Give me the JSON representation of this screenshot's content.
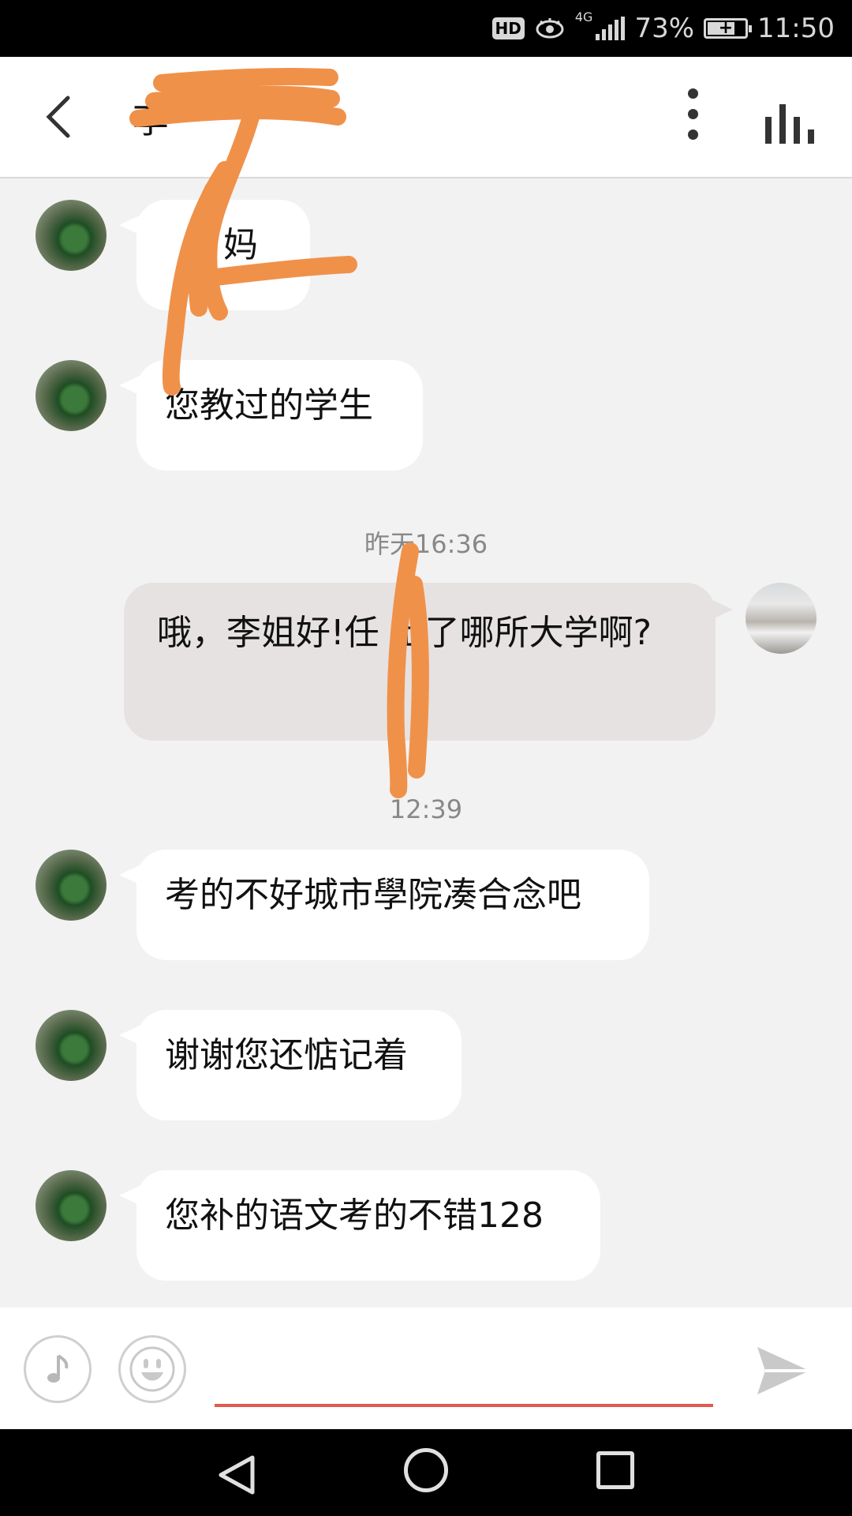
{
  "status_bar": {
    "hd": "HD",
    "network": "4G",
    "battery": "73%",
    "battery_level": 0.73,
    "time": "11:50"
  },
  "header": {
    "title": "李",
    "icons": [
      "back-arrow-icon",
      "more-vertical-icon",
      "stats-bars-icon"
    ]
  },
  "messages": [
    {
      "direction": "in",
      "avatar": "plant",
      "text": "妈"
    },
    {
      "direction": "in",
      "avatar": "plant",
      "text": "您教过的学生"
    },
    {
      "type": "timestamp",
      "text": "昨天16:36"
    },
    {
      "direction": "out",
      "avatar": "waterfall",
      "text": "哦，李姐好!任 上了哪所大学啊?"
    },
    {
      "type": "timestamp",
      "text": "12:39"
    },
    {
      "direction": "in",
      "avatar": "plant",
      "text": "考的不好城市學院凑合念吧"
    },
    {
      "direction": "in",
      "avatar": "plant",
      "text": "谢谢您还惦记着"
    },
    {
      "direction": "in",
      "avatar": "plant",
      "text": "您补的语文考的不错128"
    }
  ],
  "input": {
    "value": "",
    "underline_color": "#e05a4f",
    "icons": [
      "voice-note-icon",
      "emoji-icon",
      "send-icon"
    ]
  },
  "colors": {
    "incoming_bubble": "#ffffff",
    "outgoing_bubble": "#e6e2e2",
    "chat_background": "#f2f2f2",
    "redaction": "#f0914a"
  }
}
